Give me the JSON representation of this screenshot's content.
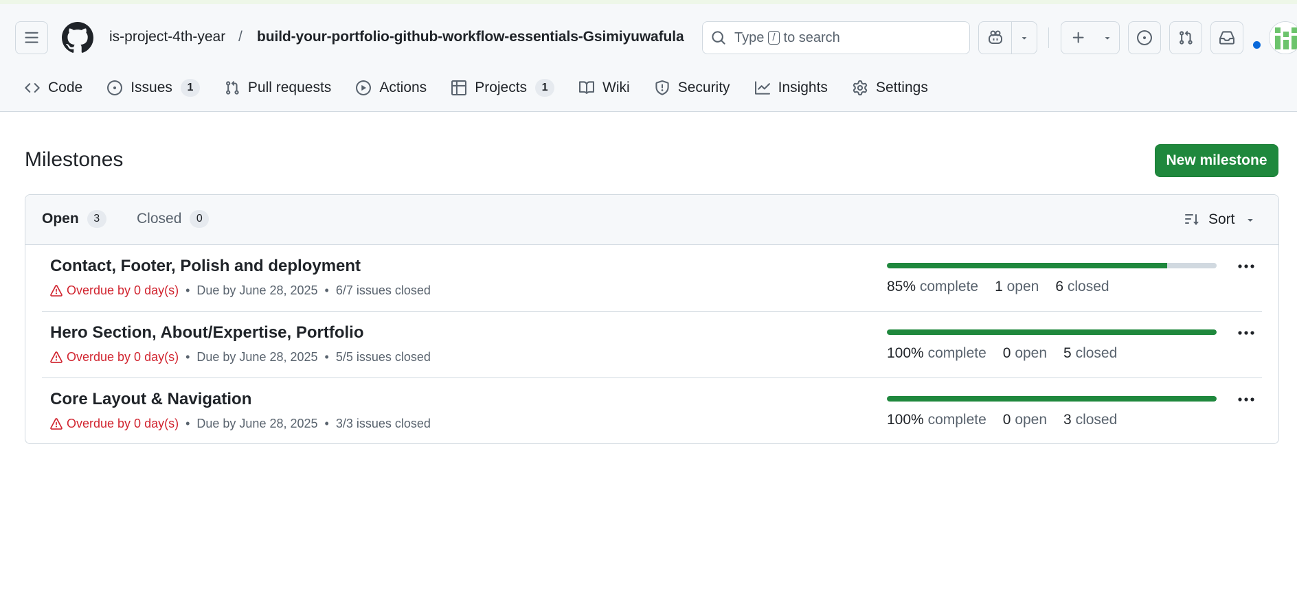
{
  "header": {
    "owner": "is-project-4th-year",
    "separator": "/",
    "repo": "build-your-portfolio-github-workflow-essentials-Gsimiyuwafula",
    "search_prefix": "Type",
    "search_key": "/",
    "search_suffix": "to search",
    "notification_dot_color": "#0969da"
  },
  "tabs": [
    {
      "label": "Code",
      "icon": "code-icon"
    },
    {
      "label": "Issues",
      "icon": "issue-opened-icon",
      "count": "1"
    },
    {
      "label": "Pull requests",
      "icon": "git-pull-request-icon"
    },
    {
      "label": "Actions",
      "icon": "play-icon"
    },
    {
      "label": "Projects",
      "icon": "table-icon",
      "count": "1"
    },
    {
      "label": "Wiki",
      "icon": "book-icon"
    },
    {
      "label": "Security",
      "icon": "shield-icon"
    },
    {
      "label": "Insights",
      "icon": "graph-icon"
    },
    {
      "label": "Settings",
      "icon": "gear-icon"
    }
  ],
  "page": {
    "title": "Milestones",
    "new_button": "New milestone",
    "accent_color": "#1f883d"
  },
  "filters": {
    "open_label": "Open",
    "open_count": "3",
    "closed_label": "Closed",
    "closed_count": "0",
    "sort_label": "Sort"
  },
  "milestones": [
    {
      "title": "Contact, Footer, Polish and deployment",
      "overdue": "Overdue by 0 day(s)",
      "due": "Due by June 28, 2025",
      "issues": "6/7 issues closed",
      "progress": 0.85,
      "percent": "85%",
      "complete_label": "complete",
      "open_count": "1",
      "open_label": "open",
      "closed_count": "6",
      "closed_label": "closed"
    },
    {
      "title": "Hero Section, About/Expertise, Portfolio",
      "overdue": "Overdue by 0 day(s)",
      "due": "Due by June 28, 2025",
      "issues": "5/5 issues closed",
      "progress": 1.0,
      "percent": "100%",
      "complete_label": "complete",
      "open_count": "0",
      "open_label": "open",
      "closed_count": "5",
      "closed_label": "closed"
    },
    {
      "title": "Core Layout & Navigation",
      "overdue": "Overdue by 0 day(s)",
      "due": "Due by June 28, 2025",
      "issues": "3/3 issues closed",
      "progress": 1.0,
      "percent": "100%",
      "complete_label": "complete",
      "open_count": "0",
      "open_label": "open",
      "closed_count": "3",
      "closed_label": "closed"
    }
  ]
}
